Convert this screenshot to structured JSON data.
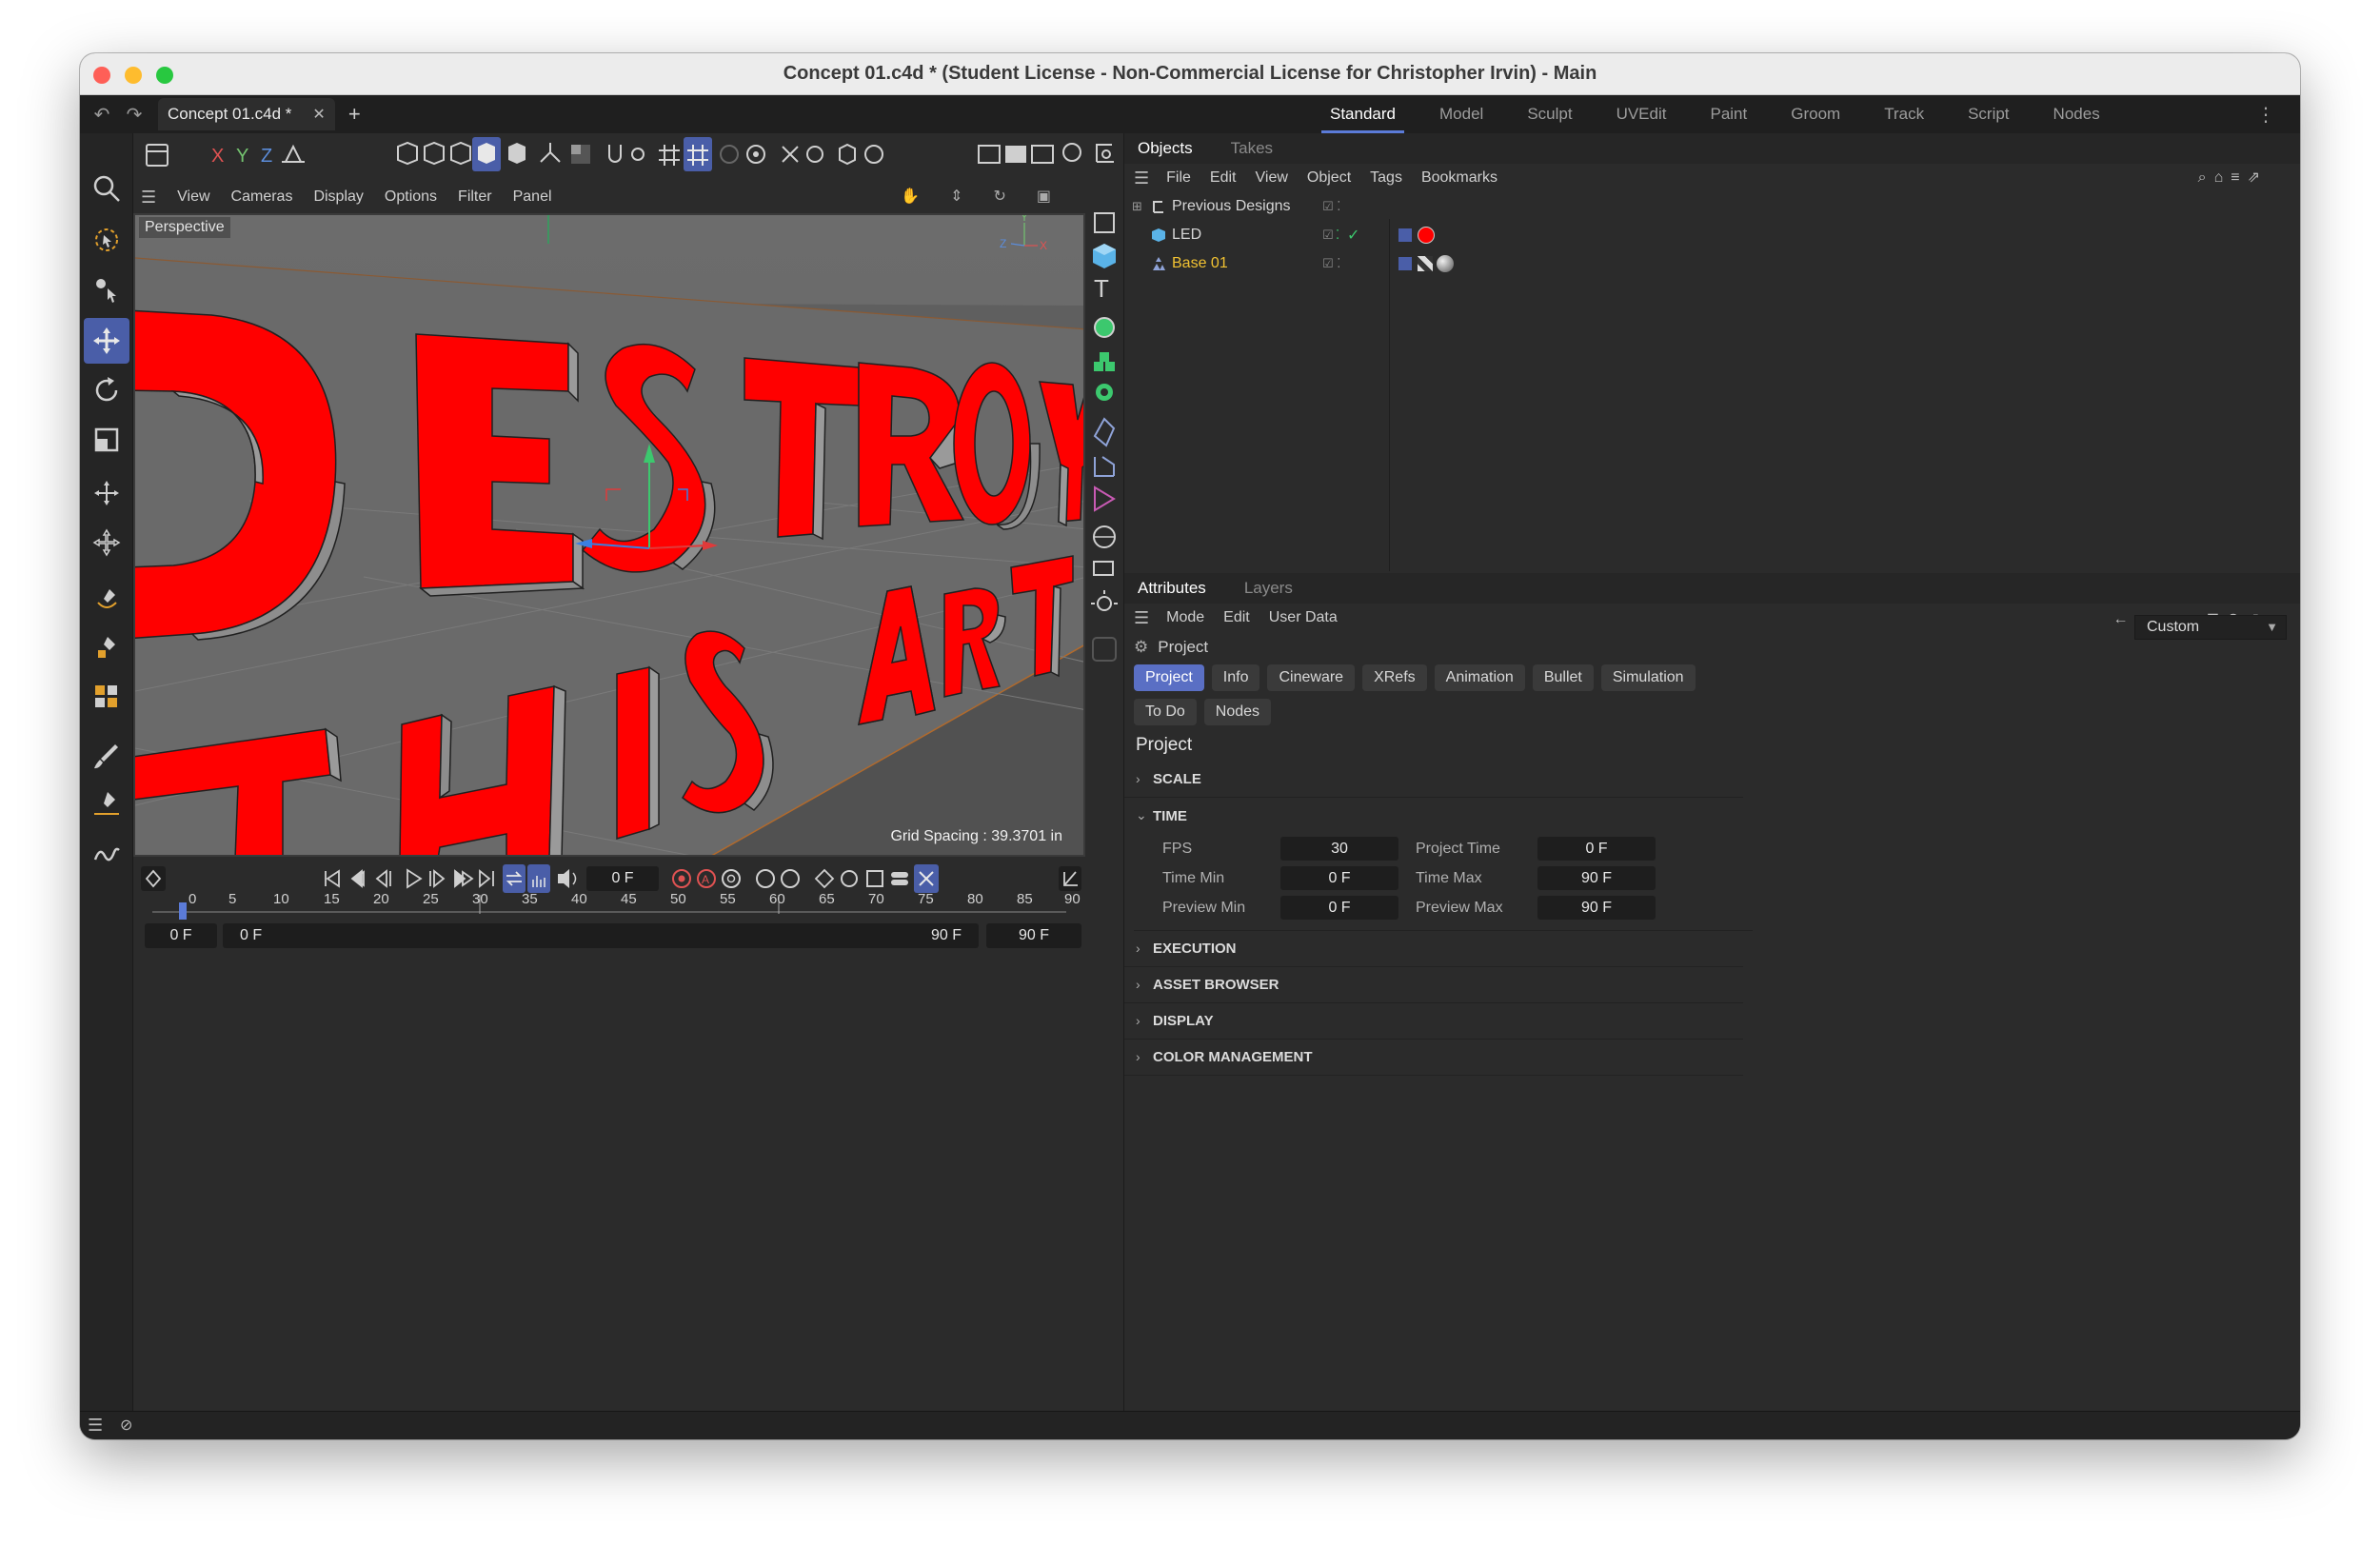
{
  "window": {
    "title": "Concept 01.c4d * (Student License - Non-Commercial License for Christopher Irvin) - Main"
  },
  "tabbar": {
    "doc_tab": "Concept 01.c4d *",
    "layouts": [
      "Standard",
      "Model",
      "Sculpt",
      "UVEdit",
      "Paint",
      "Groom",
      "Track",
      "Script",
      "Nodes"
    ],
    "active_layout": "Standard"
  },
  "toolbar": {
    "axes": [
      "X",
      "Y",
      "Z"
    ]
  },
  "viewport": {
    "menu": [
      "View",
      "Cameras",
      "Display",
      "Options",
      "Filter",
      "Panel"
    ],
    "camera_label": "Perspective",
    "grid_spacing": "Grid Spacing : 39.3701 in",
    "scene_text_line1": "DESTROY",
    "scene_text_line2": "THIS ART"
  },
  "objects_panel": {
    "tabs": [
      "Objects",
      "Takes"
    ],
    "menu": [
      "File",
      "Edit",
      "View",
      "Object",
      "Tags",
      "Bookmarks"
    ],
    "rows": [
      {
        "name": "Previous Designs",
        "color": "#d6d6d6"
      },
      {
        "name": "LED",
        "color": "#d6d6d6"
      },
      {
        "name": "Base 01",
        "color": "#f1c232"
      }
    ]
  },
  "attributes_panel": {
    "tabs": [
      "Attributes",
      "Layers"
    ],
    "menu": [
      "Mode",
      "Edit",
      "User Data"
    ],
    "context": "Project",
    "preset": "Custom",
    "buttons_row1": [
      "Project",
      "Info",
      "Cineware",
      "XRefs",
      "Animation",
      "Bullet",
      "Simulation"
    ],
    "buttons_row2": [
      "To Do",
      "Nodes"
    ],
    "active_button": "Project",
    "section_title": "Project",
    "groups_before": [
      "SCALE"
    ],
    "time_group": "TIME",
    "time_fields": {
      "fps_label": "FPS",
      "fps": "30",
      "project_time_label": "Project Time",
      "project_time": "0 F",
      "time_min_label": "Time Min",
      "time_min": "0 F",
      "time_max_label": "Time Max",
      "time_max": "90 F",
      "preview_min_label": "Preview Min",
      "preview_min": "0 F",
      "preview_max_label": "Preview Max",
      "preview_max": "90 F"
    },
    "groups_after": [
      "EXECUTION",
      "ASSET BROWSER",
      "DISPLAY",
      "COLOR MANAGEMENT"
    ]
  },
  "timeline": {
    "current_frame": "0 F",
    "ruler_ticks": [
      "0",
      "5",
      "10",
      "15",
      "20",
      "25",
      "30",
      "35",
      "40",
      "45",
      "50",
      "55",
      "60",
      "65",
      "70",
      "75",
      "80",
      "85",
      "90"
    ],
    "range_start": "0 F",
    "preview_start": "0 F",
    "preview_end": "90 F",
    "range_end": "90 F"
  },
  "colors": {
    "accent": "#4a5ea8",
    "letter_red": "#ff0000",
    "selected_object": "#f1c232"
  }
}
